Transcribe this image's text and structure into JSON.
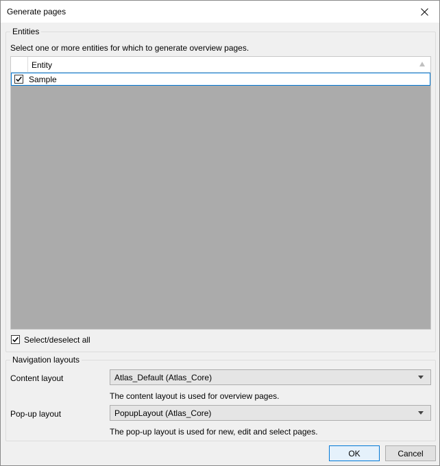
{
  "window": {
    "title": "Generate pages"
  },
  "entities": {
    "legend": "Entities",
    "description": "Select one or more entities for which to generate overview pages.",
    "column_header": "Entity",
    "rows": [
      {
        "label": "Sample",
        "checked": true
      }
    ],
    "select_all_label": "Select/deselect all"
  },
  "navigation": {
    "legend": "Navigation layouts",
    "content_label": "Content layout",
    "content_value": "Atlas_Default (Atlas_Core)",
    "content_hint": "The content layout is used for overview pages.",
    "popup_label": "Pop-up layout",
    "popup_value": "PopupLayout (Atlas_Core)",
    "popup_hint": "The pop-up layout is used for new, edit and select pages."
  },
  "buttons": {
    "ok": "OK",
    "cancel": "Cancel"
  },
  "icons": {
    "close": "close-icon",
    "check": "checkmark-icon",
    "dropdown": "chevron-down-icon",
    "sort": "sort-ascending-icon"
  },
  "colors": {
    "accent": "#0078d7",
    "grid_background": "#ababab"
  }
}
